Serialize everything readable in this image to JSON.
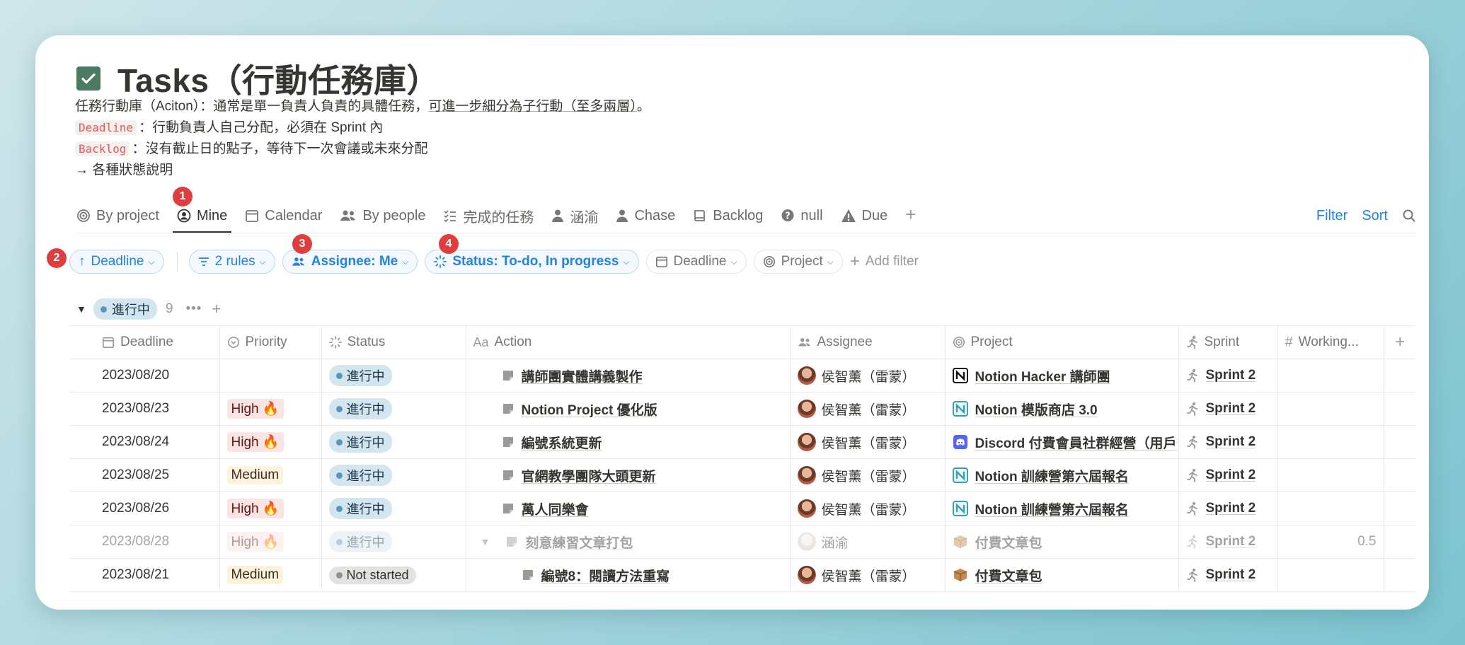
{
  "page": {
    "title": "Tasks（行動任務庫）",
    "desc": {
      "line1_a": "任務行動庫（Aciton）：通常是單一負責人負責的具體任務，",
      "line1_b": "可進一步細分為子行動（至多兩層）",
      "line1_c": "。",
      "deadline_code": "Deadline",
      "deadline_text": "：行動負責人自己分配，必須在 Sprint 內",
      "backlog_code": "Backlog",
      "backlog_text": "：沒有截止日的點子，等待下一次會議或未來分配",
      "link": "→ 各種狀態說明"
    }
  },
  "tabs": [
    {
      "label": "By project",
      "icon": "target-icon"
    },
    {
      "label": "Mine",
      "icon": "user-circle-icon",
      "active": true
    },
    {
      "label": "Calendar",
      "icon": "calendar-icon"
    },
    {
      "label": "By people",
      "icon": "people-icon"
    },
    {
      "label": "完成的任務",
      "icon": "checklist-icon"
    },
    {
      "label": "涵渝",
      "icon": "person-icon"
    },
    {
      "label": "Chase",
      "icon": "person-icon"
    },
    {
      "label": "Backlog",
      "icon": "book-icon"
    },
    {
      "label": "null",
      "icon": "question-icon"
    },
    {
      "label": "Due",
      "icon": "warning-icon"
    }
  ],
  "tab_actions": {
    "filter": "Filter",
    "sort": "Sort"
  },
  "annotations": [
    "1",
    "2",
    "3",
    "4"
  ],
  "filters": {
    "sort": "Deadline",
    "rules": "2 rules",
    "assignee": "Assignee: Me",
    "status": "Status: To-do, In progress",
    "deadline": "Deadline",
    "project": "Project",
    "add_filter": "Add filter"
  },
  "group": {
    "label": "進行中",
    "count": "9"
  },
  "columns": [
    "Deadline",
    "Priority",
    "Status",
    "Action",
    "Assignee",
    "Project",
    "Sprint",
    "Working..."
  ],
  "rows": [
    {
      "deadline": "2023/08/20",
      "priority": "",
      "status": "進行中",
      "action": "講師團實體講義製作",
      "assignee": "侯智薰（雷蒙）",
      "project": "Notion Hacker 講師團",
      "project_icon": "notion-icon",
      "sprint": "Sprint 2",
      "working": ""
    },
    {
      "deadline": "2023/08/23",
      "priority": "High 🔥",
      "status": "進行中",
      "action": "Notion Project 優化版",
      "assignee": "侯智薰（雷蒙）",
      "project": "Notion 模版商店 3.0",
      "project_icon": "notion-blue-icon",
      "sprint": "Sprint 2",
      "working": ""
    },
    {
      "deadline": "2023/08/24",
      "priority": "High 🔥",
      "status": "進行中",
      "action": "編號系統更新",
      "assignee": "侯智薰（雷蒙）",
      "project": "Discord 付費會員社群經營（用戶",
      "project_icon": "discord-icon",
      "sprint": "Sprint 2",
      "working": ""
    },
    {
      "deadline": "2023/08/25",
      "priority": "Medium",
      "status": "進行中",
      "action": "官網教學團隊大頭更新",
      "assignee": "侯智薰（雷蒙）",
      "project": "Notion 訓練營第六屆報名",
      "project_icon": "notion-blue-icon",
      "sprint": "Sprint 2",
      "working": ""
    },
    {
      "deadline": "2023/08/26",
      "priority": "High 🔥",
      "status": "進行中",
      "action": "萬人同樂會",
      "assignee": "侯智薰（雷蒙）",
      "project": "Notion 訓練營第六屆報名",
      "project_icon": "notion-blue-icon",
      "sprint": "Sprint 2",
      "working": ""
    },
    {
      "deadline": "2023/08/28",
      "priority": "High 🔥",
      "status": "進行中",
      "action": "刻意練習文章打包",
      "assignee": "涵渝",
      "project": "付費文章包",
      "project_icon": "box-icon",
      "sprint": "Sprint 2",
      "working": "0.5",
      "faded": true,
      "expandable": true
    },
    {
      "deadline": "2023/08/21",
      "priority": "Medium",
      "status": "Not started",
      "action": "編號8：閱讀方法重寫",
      "assignee": "侯智薰（雷蒙）",
      "project": "付費文章包",
      "project_icon": "box-icon",
      "sprint": "Sprint 2",
      "working": "",
      "subitem": true
    }
  ]
}
